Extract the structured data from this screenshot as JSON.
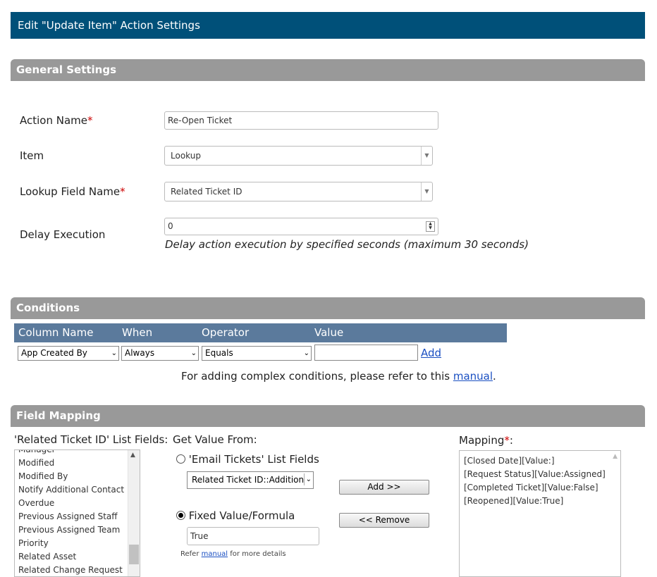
{
  "dialog": {
    "title": "Edit \"Update Item\" Action Settings"
  },
  "general": {
    "heading": "General Settings",
    "action_name_label": "Action Name",
    "action_name_value": "Re-Open Ticket",
    "item_label": "Item",
    "item_value": "Lookup",
    "lookup_label": "Lookup Field Name",
    "lookup_value": "Related Ticket ID",
    "delay_label": "Delay Execution",
    "delay_value": "0",
    "delay_hint": "Delay action execution by specified seconds (maximum 30 seconds)",
    "required_mark": "*"
  },
  "conditions": {
    "heading": "Conditions",
    "columns": [
      "Column Name",
      "When",
      "Operator",
      "Value"
    ],
    "column_value": "App Created By",
    "when_value": "Always",
    "operator_value": "Equals",
    "value_value": "",
    "add_label": "Add",
    "note_prefix": "For adding complex conditions, please refer to this ",
    "note_link": "manual",
    "note_suffix": "."
  },
  "mapping": {
    "heading": "Field Mapping",
    "list_fields_label": "'Related Ticket ID' List Fields:",
    "list_fields": [
      "Manager",
      "Modified",
      "Modified By",
      "Notify Additional Contact",
      "Overdue",
      "Previous Assigned Staff",
      "Previous Assigned Team",
      "Priority",
      "Related Asset",
      "Related Change Request"
    ],
    "get_value_label": "Get Value From:",
    "radio_list_label": "'Email Tickets' List Fields",
    "list_select_value": "Related Ticket ID::Addition",
    "radio_fixed_label": "Fixed Value/Formula",
    "fixed_value": "True",
    "refer_prefix": "Refer ",
    "refer_link": "manual",
    "refer_suffix": " for more details",
    "add_button": "Add >>",
    "remove_button": "<< Remove",
    "mapping_label": "Mapping",
    "mappings": [
      "[Closed Date][Value:]",
      "[Request Status][Value:Assigned]",
      "[Completed Ticket][Value:False]",
      "[Reopened][Value:True]"
    ]
  }
}
